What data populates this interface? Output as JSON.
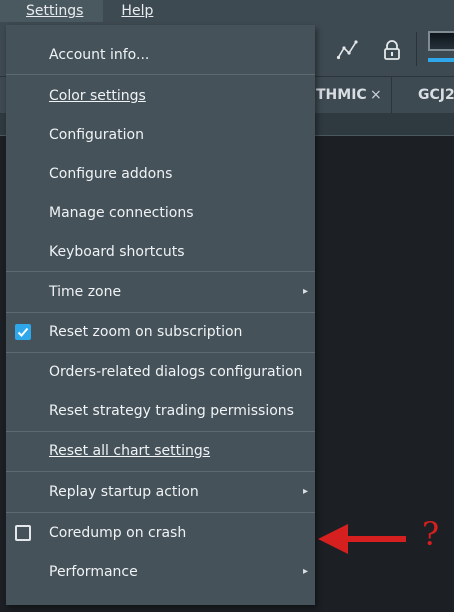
{
  "menubar": {
    "settings_label": "Settings",
    "help_label": "Help"
  },
  "toolbar": {
    "icons": [
      "line-chart-icon",
      "lock-icon"
    ]
  },
  "tabs": [
    {
      "label": "THMIC",
      "close": "×"
    },
    {
      "label": "GCJ2"
    }
  ],
  "settings_menu": {
    "items": {
      "account_info": "Account info...",
      "color_settings": "Color settings",
      "configuration": "Configuration",
      "configure_addons": "Configure addons",
      "manage_connections": "Manage connections",
      "keyboard_shortcuts": "Keyboard shortcuts",
      "time_zone": "Time zone",
      "reset_zoom": "Reset zoom on subscription",
      "orders_dialogs": "Orders-related dialogs configuration",
      "reset_strategy": "Reset strategy trading permissions",
      "reset_chart": "Reset all chart settings",
      "replay_startup": "Replay startup action",
      "coredump": "Coredump on crash",
      "performance": "Performance"
    },
    "submenu_marker": "▸",
    "reset_zoom_checked": true,
    "coredump_checked": false
  },
  "annotation": {
    "question_mark": "?",
    "color": "#d61f1f"
  },
  "colors": {
    "accent": "#2ea8ea",
    "menu_bg": "#45525a",
    "chrome_bg": "#3e4a52"
  }
}
